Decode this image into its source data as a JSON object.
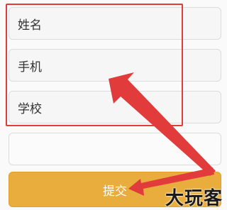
{
  "form": {
    "name_placeholder": "姓名",
    "phone_placeholder": "手机",
    "school_placeholder": "学校",
    "extra_placeholder": "",
    "submit_label": "提交"
  },
  "annotation": {
    "highlight_color": "#e23b3b",
    "watermark": "大玩客"
  },
  "colors": {
    "submit_bg": "#e8ad3c",
    "field_bg": "#f6f6f6"
  }
}
